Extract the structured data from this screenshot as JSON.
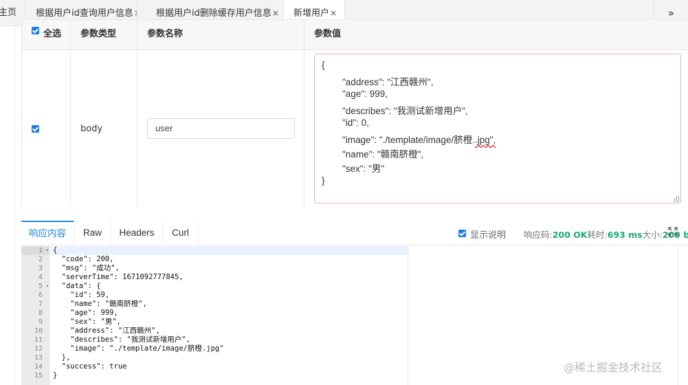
{
  "tabs": [
    {
      "label": "主页",
      "closable": false,
      "active": false
    },
    {
      "label": "根据用户id查询用户信息",
      "closable": true,
      "active": false
    },
    {
      "label": "根据用户id删除缓存用户信息",
      "closable": true,
      "active": false
    },
    {
      "label": "新增用户",
      "closable": true,
      "active": true
    }
  ],
  "tab_close_glyph": "×",
  "tab_more_glyph": "»",
  "params_table": {
    "headers": {
      "select_all": "全选",
      "type": "参数类型",
      "name": "参数名称",
      "value": "参数值"
    },
    "row": {
      "checked": true,
      "type": "body",
      "name_value": "user",
      "value_lines": [
        "{",
        "        \"address\": \"江西赣州\",",
        "        \"age\": 999,",
        "        \"describes\": \"我测试新增用户\",",
        "        \"id\": 0,",
        "        \"image\": \"./template/image/脐橙.",
        ".jpg\",",
        "        \"name\": \"赣南脐橙\",",
        "        \"sex\": \"男\"",
        "}"
      ]
    }
  },
  "response_tabs": [
    "响应内容",
    "Raw",
    "Headers",
    "Curl"
  ],
  "show_desc": {
    "checked": true,
    "label": "显示说明"
  },
  "status": {
    "code_label": "响应码:",
    "code_value": "200 OK",
    "time_label": "耗时:",
    "time_value": "693 ms",
    "size_label": "大小:",
    "size_value": "209 b"
  },
  "code_lines": [
    "{",
    "  \"code\": 200,",
    "  \"msg\": \"成功\",",
    "  \"serverTime\": 1671092777845,",
    "  \"data\": {",
    "    \"id\": 59,",
    "    \"name\": \"赣南脐橙\",",
    "    \"age\": 999,",
    "    \"sex\": \"男\",",
    "    \"address\": \"江西赣州\",",
    "    \"describes\": \"我测试新增用户\",",
    "    \"image\": \"./template/image/脐橙.jpg\"",
    "  },",
    "  \"success\": true",
    "}"
  ],
  "line_numbers": [
    "1",
    "2",
    "3",
    "4",
    "5",
    "6",
    "7",
    "8",
    "9",
    "10",
    "11",
    "12",
    "13",
    "14",
    "15"
  ],
  "fold_glyph": "▾",
  "watermark": "@稀土掘金技术社区",
  "colors": {
    "accent": "#1e88e5",
    "checkbox": "#1e7be6",
    "status_green": "#19a974",
    "value_border": "#e8b4b4"
  },
  "icons": [
    "checkbox-icon",
    "close-icon",
    "double-chevron-right-icon",
    "fullscreen-icon",
    "fold-arrow-icon",
    "resize-grip-icon"
  ]
}
